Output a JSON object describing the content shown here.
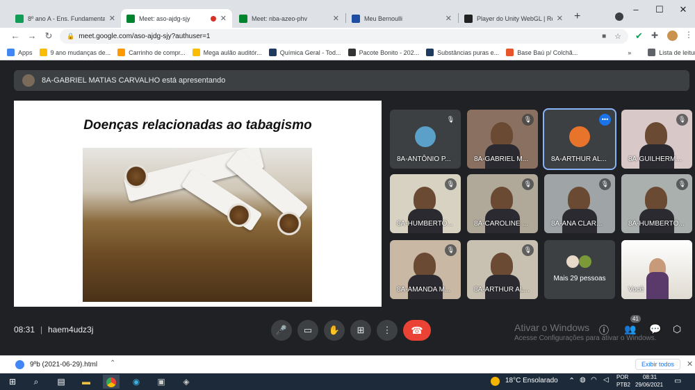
{
  "browser": {
    "tabs": [
      {
        "label": "8º ano A - Ens. Fundamental",
        "favicon_color": "#0f9d58"
      },
      {
        "label": "Meet: aso-ajdg-sjy",
        "favicon_color": "#00832d",
        "recording": true
      },
      {
        "label": "Meet: nba-azeo-phv",
        "favicon_color": "#00832d"
      },
      {
        "label": "Meu Bernoulli",
        "favicon_color": "#1e4ea1"
      },
      {
        "label": "Player do Unity WebGL | Reci",
        "favicon_color": "#222222"
      }
    ],
    "new_tab": "+",
    "url": "meet.google.com/aso-ajdg-sjy?authuser=1",
    "bookmarks": [
      {
        "label": "Apps",
        "icon_color": "#4285f4"
      },
      {
        "label": "9 ano mudanças de...",
        "icon_color": "#fbbc05"
      },
      {
        "label": "Carrinho de compr...",
        "icon_color": "#ff9900"
      },
      {
        "label": "Mega aulão auditór...",
        "icon_color": "#fbbc05"
      },
      {
        "label": "Química Geral - Tod...",
        "icon_color": "#1e3a5f"
      },
      {
        "label": "Pacote Bonito - 202...",
        "icon_color": "#333333"
      },
      {
        "label": "Substâncias puras e...",
        "icon_color": "#1e3a5f"
      },
      {
        "label": "Base Baú p/ Colchã...",
        "icon_color": "#e8552b"
      }
    ],
    "bookmarks_more": "»",
    "reading_list": "Lista de leitura"
  },
  "meet": {
    "presenting_banner": "8A-GABRIEL MATIAS CARVALHO está apresentando",
    "slide_title": "Doenças relacionadas ao tabagismo",
    "participants": [
      {
        "name": "8A-ANTÔNIO P...",
        "bg": "#3c4043",
        "type": "avatar"
      },
      {
        "name": "8A-GABRIEL M...",
        "bg": "#8a7060",
        "type": "video"
      },
      {
        "name": "8A-ARTHUR AL...",
        "bg": "#3c4043",
        "type": "avatar",
        "active": true
      },
      {
        "name": "8A-GUILHERM...",
        "bg": "#d9c8c8",
        "type": "video"
      },
      {
        "name": "8A-HUMBERTO...",
        "bg": "#d8d2c2",
        "type": "video"
      },
      {
        "name": "8A-CAROLINE ...",
        "bg": "#b0a898",
        "type": "video"
      },
      {
        "name": "8A-ANA CLAR...",
        "bg": "#9fa4a6",
        "type": "video"
      },
      {
        "name": "8A-HUMBERTO...",
        "bg": "#aab0ae",
        "type": "video"
      },
      {
        "name": "8A-AMANDA M...",
        "bg": "#c8b8a4",
        "type": "video"
      },
      {
        "name": "8A-ARTHUR AL...",
        "bg": "#c8c0b0",
        "type": "video"
      }
    ],
    "more_people": "Mais 29 pessoas",
    "self_label": "Você",
    "time": "08:31",
    "meeting_code": "haem4udz3j",
    "people_count": "41",
    "activation_title": "Ativar o Windows",
    "activation_sub": "Acesse Configurações para ativar o Windows."
  },
  "downloads": {
    "file": "9ºb (2021-06-29).html",
    "show_all": "Exibir todos"
  },
  "taskbar": {
    "weather": "18°C Ensolarado",
    "lang1": "POR",
    "lang2": "PTB2",
    "time": "08:31",
    "date": "29/06/2021"
  }
}
